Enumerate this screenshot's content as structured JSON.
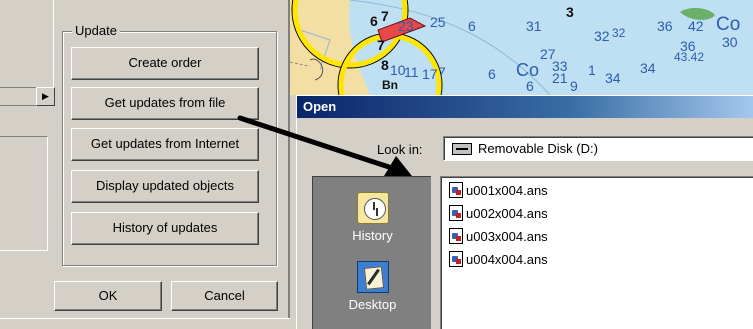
{
  "left_panel": {
    "group_title": "Update",
    "buttons": [
      "Create order",
      "Get updates from file",
      "Get updates from Internet",
      "Display updated objects",
      "History of updates"
    ],
    "scroll_right_glyph": "▶",
    "ok_label": "OK",
    "cancel_label": "Cancel"
  },
  "chart_background": {
    "depths": [
      "6",
      "7",
      "7",
      "8",
      "23",
      "25",
      "6",
      "3",
      "31",
      "32",
      "36",
      "42",
      "Co",
      "36",
      "30",
      "43.42",
      "27",
      "33",
      "34",
      "34",
      "Co",
      "21",
      "9",
      "10",
      "11",
      "17",
      "7",
      "6",
      "32",
      "Bn",
      "6",
      "1"
    ]
  },
  "open_dialog": {
    "title": "Open",
    "look_in_label": "Look in:",
    "look_in_value": "Removable Disk (D:)",
    "drive_icon": "removable-disk-icon",
    "places": [
      {
        "label": "History",
        "icon": "history-icon"
      },
      {
        "label": "Desktop",
        "icon": "desktop-icon"
      }
    ],
    "files": [
      "u001x004.ans",
      "u002x004.ans",
      "u003x004.ans",
      "u004x004.ans"
    ]
  },
  "colors": {
    "window_face": "#d4d0c8",
    "title_bar": "#0a246a",
    "chart_land": "#f3dfa4",
    "chart_water": "#bfe0f2",
    "depth_text": "#2a5db0"
  }
}
